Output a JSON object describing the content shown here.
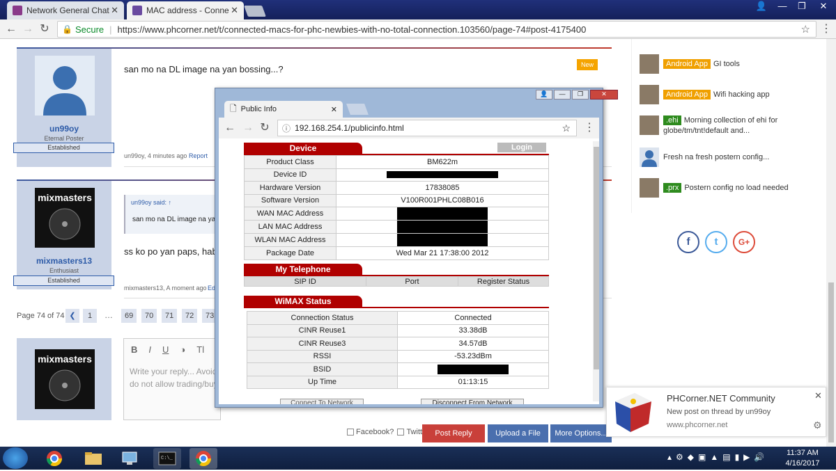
{
  "browser": {
    "tabs": [
      {
        "title": "Network General Chat",
        "active": false
      },
      {
        "title": "MAC address - Connecte",
        "active": true
      }
    ],
    "window_controls": {
      "user": "👤",
      "minimize": "—",
      "maximize": "❐",
      "close": "✕"
    },
    "secure_label": "Secure",
    "url": "https://www.phcorner.net/t/connected-macs-for-phc-newbies-with-no-total-connection.103560/page-74#post-4175400"
  },
  "posts": [
    {
      "username": "un99oy",
      "user_title": "Eternal Poster",
      "badge": "Established",
      "message": "san mo na DL image na yan bossing...?",
      "meta_author": "un99oy, 4 minutes ago",
      "report": "Report",
      "new_badge": "New"
    },
    {
      "username": "mixmasters13",
      "user_title": "Enthusiast",
      "badge": "Established",
      "avatar_text": "mixmasters",
      "quote_author": "un99oy said: ↑",
      "quote_text": "san mo na DL image na yan b",
      "message": "ss ko po yan paps, habang",
      "meta_author": "mixmasters13, A moment ago",
      "meta_edit": "Ed"
    }
  ],
  "pagination": {
    "label": "Page 74 of 74",
    "prev": "❮",
    "pages": [
      "1",
      "…",
      "69",
      "70",
      "71",
      "72",
      "73"
    ]
  },
  "reply": {
    "avatar_text": "mixmasters",
    "toolbar": [
      "B",
      "I",
      "U",
      "◑",
      "Tl"
    ],
    "placeholder_line1": "Write your reply... Avoid",
    "placeholder_line2": "do not allow trading/buy",
    "facebook_label": "Facebook?",
    "twitter_label": "Twitter",
    "post_reply": "Post Reply",
    "upload": "Upload a File",
    "more": "More Options..."
  },
  "sidebar": {
    "items": [
      {
        "tag": "Android App",
        "tag_color": "#f0a000",
        "text": "GI tools"
      },
      {
        "tag": "Android App",
        "tag_color": "#f0a000",
        "text": "Wifi hacking app"
      },
      {
        "tag": ".ehi",
        "tag_color": "#2e8b1e",
        "text": "Morning collection of ehi for",
        "text2": "globe/tm/tnt!default and..."
      },
      {
        "tag": "",
        "tag_color": "",
        "text": "Fresh na fresh postern config..."
      },
      {
        "tag": ".prx",
        "tag_color": "#2e8b1e",
        "text": "Postern config no load needed"
      }
    ],
    "social": [
      {
        "glyph": "f",
        "color": "#3b5998"
      },
      {
        "glyph": "t",
        "color": "#55acee"
      },
      {
        "glyph": "G+",
        "color": "#dd4b39"
      }
    ]
  },
  "popup": {
    "tab_title": "Public Info",
    "url": "192.168.254.1/publicinfo.html",
    "login": "Login",
    "device": {
      "title": "Device",
      "rows": [
        {
          "label": "Product Class",
          "value": "BM622m",
          "redacted": false
        },
        {
          "label": "Device ID",
          "value": "",
          "redacted": true
        },
        {
          "label": "Hardware Version",
          "value": "17838085",
          "redacted": false
        },
        {
          "label": "Software Version",
          "value": "V100R001PHLC08B016",
          "redacted": false
        },
        {
          "label": "WAN MAC Address",
          "value": "",
          "redacted": true
        },
        {
          "label": "LAN MAC Address",
          "value": "",
          "redacted": true
        },
        {
          "label": "WLAN MAC Address",
          "value": "",
          "redacted": true
        },
        {
          "label": "Package Date",
          "value": "Wed Mar 21 17:38:00 2012",
          "redacted": false
        }
      ]
    },
    "telephone": {
      "title": "My Telephone",
      "headers": [
        "SIP ID",
        "Port",
        "Register Status"
      ]
    },
    "wimax": {
      "title": "WiMAX Status",
      "headers": [
        "Connection Status",
        "Connected"
      ],
      "rows": [
        {
          "label": "CINR Reuse1",
          "value": "33.38dB",
          "redacted": false
        },
        {
          "label": "CINR Reuse3",
          "value": "34.57dB",
          "redacted": false
        },
        {
          "label": "RSSI",
          "value": "-53.23dBm",
          "redacted": false
        },
        {
          "label": "BSID",
          "value": "",
          "redacted": true
        },
        {
          "label": "Up Time",
          "value": "01:13:15",
          "redacted": false
        }
      ],
      "connect_btn": "Connect To Network",
      "disconnect_btn": "Disconnect From Network"
    }
  },
  "notification": {
    "title": "PHCorner.NET Community",
    "body": "New post on thread by un99oy",
    "site": "www.phcorner.net"
  },
  "taskbar": {
    "time": "11:37 AM",
    "date": "4/16/2017"
  }
}
